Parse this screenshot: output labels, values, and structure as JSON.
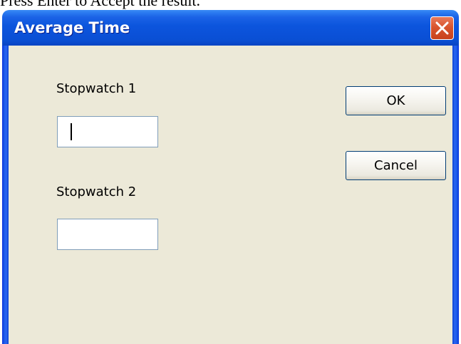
{
  "instruction": "Press Enter to Accept the result.",
  "window": {
    "title": "Average Time"
  },
  "form": {
    "stopwatch1_label": "Stopwatch 1",
    "stopwatch1_value": "",
    "stopwatch2_label": "Stopwatch 2",
    "stopwatch2_value": ""
  },
  "buttons": {
    "ok_label": "OK",
    "cancel_label": "Cancel"
  },
  "icons": {
    "close": "close-icon"
  },
  "colors": {
    "titlebar": "#0c55dd",
    "client": "#ece9d8",
    "close_button": "#d9552e"
  }
}
